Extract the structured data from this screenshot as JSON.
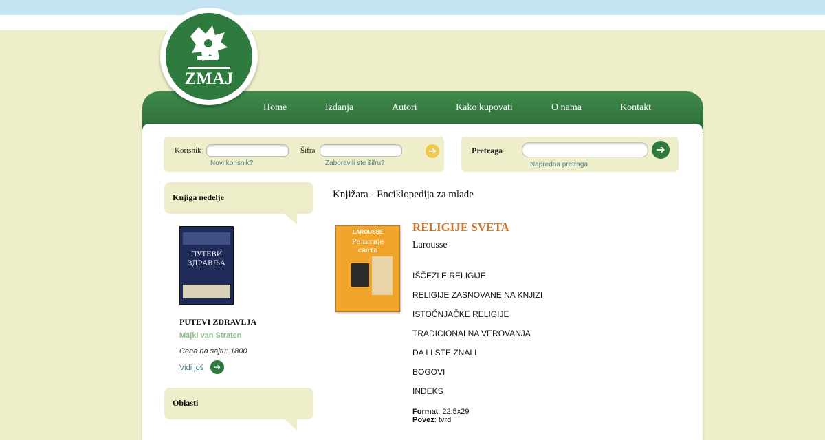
{
  "brand": {
    "logo_text": "ZMAJ"
  },
  "nav": {
    "items": [
      "Home",
      "Izdanja",
      "Autori",
      "Kako kupovati",
      "O nama",
      "Kontakt"
    ]
  },
  "login": {
    "user_label": "Korisnik",
    "user_value": "",
    "password_label": "Šifra",
    "password_value": "",
    "new_user_link": "Novi korisnik?",
    "forgot_link": "Zaboravili ste šifru?"
  },
  "search": {
    "label": "Pretraga",
    "value": "",
    "advanced_link": "Napredna pretraga"
  },
  "sidebar": {
    "book_of_week_title": "Knjiga nedelje",
    "featured": {
      "cover_title": "ПУТЕВИ ЗДРАВЉА",
      "title": "PUTEVI ZDRAVLJA",
      "author": "Majkl van Straten",
      "price": "Cena na sajtu: 1800",
      "more_link": "Vidi još"
    },
    "categories_title": "Oblasti"
  },
  "main": {
    "breadcrumb": "Knjižara - Enciklopedija za mlade",
    "book": {
      "cover_text": "Религије света",
      "cover_brand": "LAROUSSE",
      "title": "RELIGIJE SVETA",
      "publisher": "Larousse",
      "contents": [
        "IŠČEZLE RELIGIJE",
        "RELIGIJE ZASNOVANE NA KNJIZI",
        "ISTOČNJAČKE RELIGIJE",
        "TRADICIONALNA VEROVANJA",
        "DA LI STE ZNALI",
        "BOGOVI",
        "INDEKS"
      ],
      "format_label": "Format",
      "format_value": ": 22,5x29",
      "binding_label": "Povez",
      "binding_value": ": tvrd"
    }
  },
  "colors": {
    "background": "#eeeecb",
    "nav_green": "#2f7a3e",
    "title_orange": "#d4752a",
    "link_teal": "#4f7f86",
    "author_green": "#8fc08f"
  },
  "icons": {
    "login_submit": "arrow-right-icon",
    "search_submit": "arrow-right-icon",
    "more": "arrow-right-icon"
  }
}
